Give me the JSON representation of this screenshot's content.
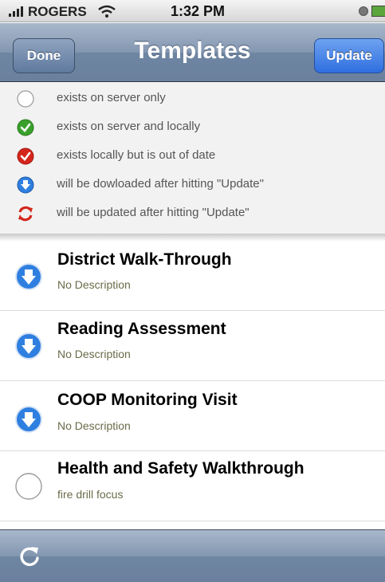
{
  "status_bar": {
    "carrier": "ROGERS",
    "time": "1:32 PM"
  },
  "navbar": {
    "title": "Templates",
    "done_label": "Done",
    "update_label": "Update"
  },
  "legend": [
    {
      "icon": "empty-circle-icon",
      "text": "exists on server only"
    },
    {
      "icon": "green-check-icon",
      "text": "exists on server and locally"
    },
    {
      "icon": "red-check-icon",
      "text": "exists locally but is out of date"
    },
    {
      "icon": "blue-download-icon",
      "text": "will be dowloaded after hitting \"Update\""
    },
    {
      "icon": "red-refresh-icon",
      "text": "will be updated after hitting \"Update\""
    }
  ],
  "templates": [
    {
      "icon": "blue-download-icon",
      "title": "District Walk-Through",
      "description": "No Description"
    },
    {
      "icon": "blue-download-icon",
      "title": "Reading Assessment",
      "description": "No Description"
    },
    {
      "icon": "blue-download-icon",
      "title": "COOP Monitoring Visit",
      "description": "No Description"
    },
    {
      "icon": "empty-circle-icon",
      "title": "Health and Safety Walkthrough",
      "description": "fire drill focus"
    }
  ],
  "colors": {
    "nav_blue": "#6f86a3",
    "update_blue": "#2f6ee0",
    "green": "#3aa02c",
    "red": "#d4261c"
  }
}
